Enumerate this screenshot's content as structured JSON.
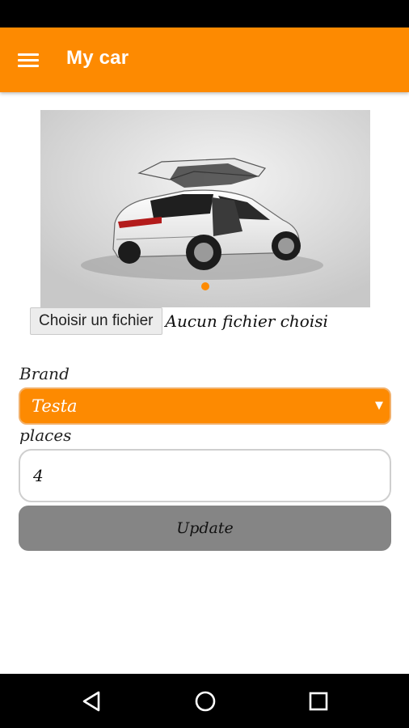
{
  "app": {
    "title": "My car",
    "accent_color": "#fd8a01"
  },
  "icons": {
    "menu": "hamburger-menu-icon",
    "back": "back-triangle-icon",
    "home": "home-circle-icon",
    "recent": "recent-apps-square-icon"
  },
  "gallery": {
    "image": "white SUV with falcon-wing doors open",
    "active_page": 1,
    "page_count": 1
  },
  "file_picker": {
    "button_label": "Choisir un fichier",
    "status": "Aucun fichier choisi"
  },
  "form": {
    "brand_label": "Brand",
    "brand_value": "Testa",
    "places_label": "places",
    "places_value": "4",
    "update_label": "Update"
  }
}
